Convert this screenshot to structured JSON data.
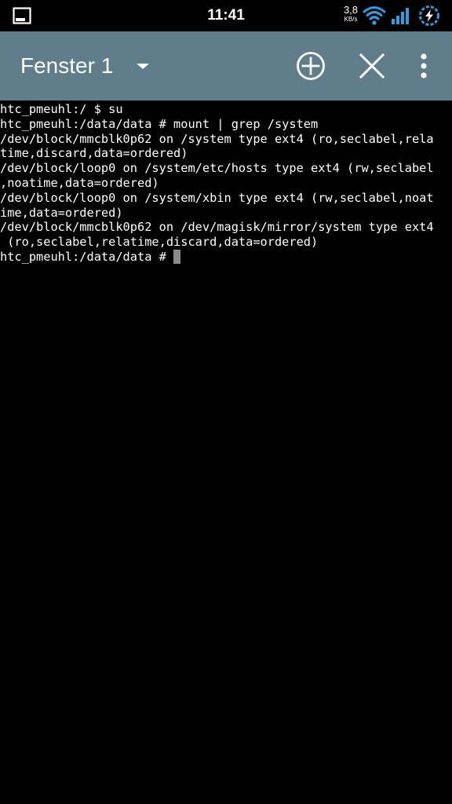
{
  "status_bar": {
    "time": "11:41",
    "net_speed_value": "3,8",
    "net_speed_unit": "KB/s",
    "left_icon": "terminal-notification-icon",
    "icons": [
      "wifi-icon",
      "cellular-signal-icon",
      "battery-charging-icon"
    ]
  },
  "toolbar": {
    "window_title": "Fenster 1",
    "dropdown_icon": "caret-down-icon",
    "add_icon": "add-circle-icon",
    "close_icon": "close-icon",
    "menu_icon": "more-vertical-icon"
  },
  "terminal": {
    "lines": [
      "htc_pmeuhl:/ $ su",
      "htc_pmeuhl:/data/data # mount | grep /system",
      "/dev/block/mmcblk0p62 on /system type ext4 (ro,seclabel,rela",
      "time,discard,data=ordered)",
      "/dev/block/loop0 on /system/etc/hosts type ext4 (rw,seclabel",
      ",noatime,data=ordered)",
      "/dev/block/loop0 on /system/xbin type ext4 (rw,seclabel,noat",
      "ime,data=ordered)",
      "/dev/block/mmcblk0p62 on /dev/magisk/mirror/system type ext4",
      " (ro,seclabel,relatime,discard,data=ordered)",
      "htc_pmeuhl:/data/data # "
    ]
  },
  "colors": {
    "action_bar": "#607d8b",
    "background": "#000000",
    "text": "#ffffff",
    "cursor": "#8a8a8a"
  }
}
